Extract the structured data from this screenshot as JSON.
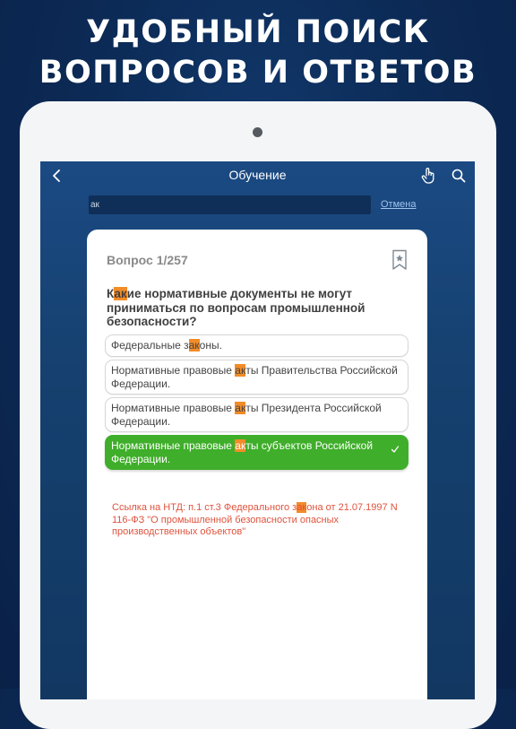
{
  "promo": {
    "line1": "УДОБНЫЙ ПОИСК",
    "line2": "ВОПРОСОВ И ОТВЕТОВ"
  },
  "nav": {
    "title": "Обучение",
    "back_icon": "chevron-left-icon",
    "hand_icon": "hand-pointer-icon",
    "search_icon": "search-icon"
  },
  "search": {
    "value": "ак",
    "cancel_label": "Отмена"
  },
  "card": {
    "counter": "Вопрос 1/257",
    "bookmark_icon": "bookmark-star-icon",
    "question": {
      "pre": "К",
      "hl": "ак",
      "post": "ие нормативные документы не могут приниматься по вопросам промышленной безопасности?"
    },
    "answers": [
      {
        "pre": "Федеральные з",
        "hl": "ак",
        "post": "оны."
      },
      {
        "pre": "Нормативные правовые ",
        "hl": "ак",
        "post": "ты Правительства Российской Федерации."
      },
      {
        "pre": "Нормативные правовые ",
        "hl": "ак",
        "post": "ты Президента Российской Федерации."
      },
      {
        "pre": "Нормативные правовые ",
        "hl": "ак",
        "post": "ты субъектов Российской Федерации."
      }
    ],
    "check_icon": "checkmark-icon",
    "reference": {
      "pre": "Ссылка на НТД: п.1 ст.3 Федерального з",
      "hl": "ак",
      "post": "она от 21.07.1997 N 116-ФЗ \"О промышленной безопасности опасных производственных объектов\""
    }
  },
  "colors": {
    "background": "#0c2b57",
    "screen": "#1b4a83",
    "highlight": "#f28c28",
    "correct": "#3fae2a",
    "reference": "#e0533d"
  }
}
